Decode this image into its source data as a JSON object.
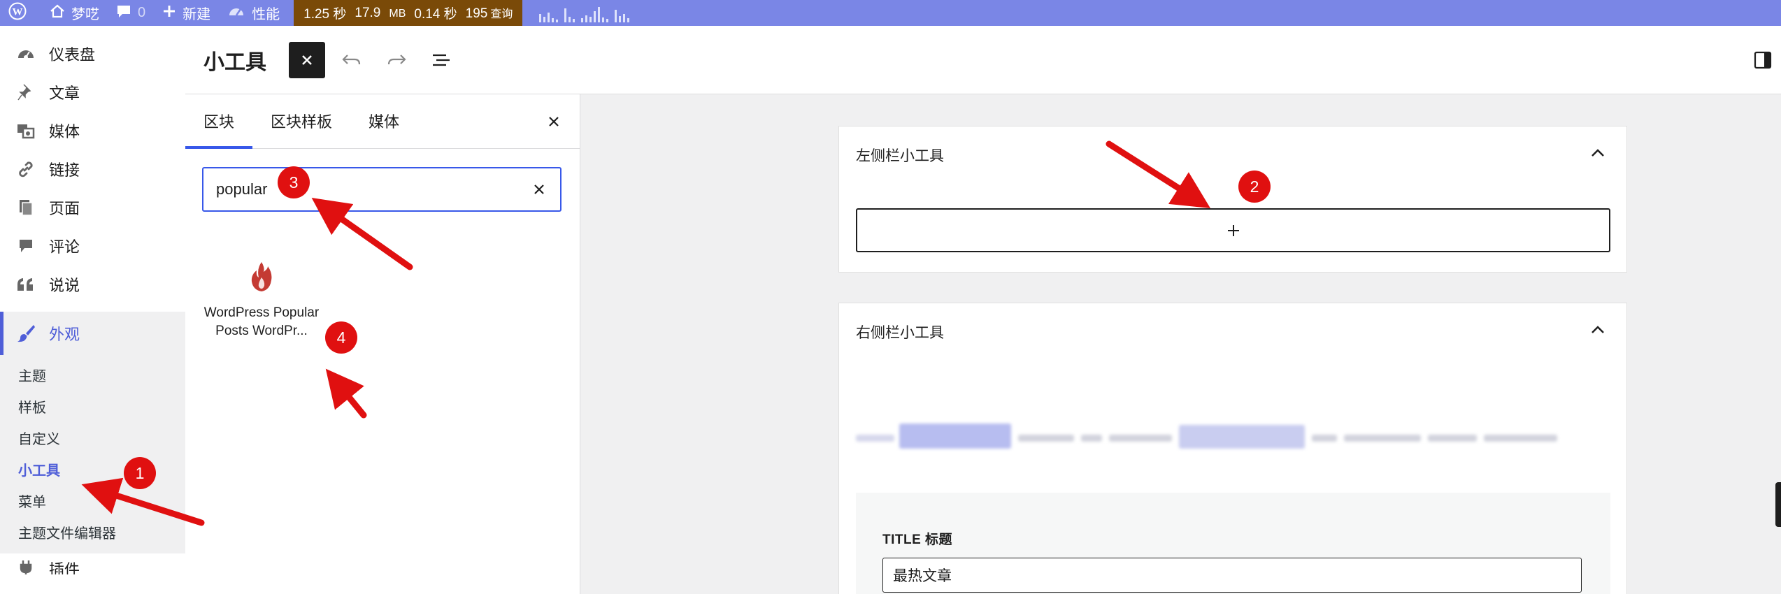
{
  "admin_bar": {
    "site_name": "梦呓",
    "comments_count": "0",
    "new_label": "新建",
    "performance_label": "性能",
    "perf_time": "1.25 秒",
    "perf_memory": "17.9",
    "perf_memory_unit": "MB",
    "perf_query_time": "0.14 秒",
    "perf_query_count": "195",
    "perf_query_label": "查询"
  },
  "admin_menu": {
    "items": [
      {
        "label": "仪表盘",
        "icon": "dashboard-icon"
      },
      {
        "label": "文章",
        "icon": "pin-icon"
      },
      {
        "label": "媒体",
        "icon": "media-icon"
      },
      {
        "label": "链接",
        "icon": "link-icon"
      },
      {
        "label": "页面",
        "icon": "pages-icon"
      },
      {
        "label": "评论",
        "icon": "comment-icon"
      },
      {
        "label": "说说",
        "icon": "quote-icon"
      }
    ],
    "current": {
      "label": "外观",
      "icon": "brush-icon"
    },
    "submenu": [
      "主题",
      "样板",
      "自定义",
      "小工具",
      "菜单",
      "主题文件编辑器"
    ],
    "active_submenu": "小工具",
    "next_item": "插件"
  },
  "editor": {
    "title": "小工具"
  },
  "inserter": {
    "tabs": [
      "区块",
      "区块样板",
      "媒体"
    ],
    "active_tab": "区块",
    "search_value": "popular",
    "result_title": "WordPress Popular Posts WordPr..."
  },
  "canvas": {
    "left_area": {
      "title": "左侧栏小工具"
    },
    "right_area": {
      "title": "右侧栏小工具"
    },
    "widget": {
      "label": "TITLE 标题",
      "title_value": "最热文章"
    }
  },
  "annotations": [
    "1",
    "2",
    "3",
    "4"
  ],
  "colors": {
    "admin_bar": "#7a86e6",
    "accent": "#4f5ed8",
    "annotation": "#e01010"
  }
}
